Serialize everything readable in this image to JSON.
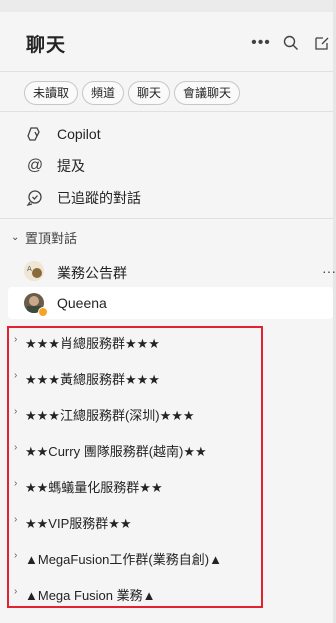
{
  "header": {
    "title": "聊天"
  },
  "filters": [
    "未讀取",
    "頻道",
    "聊天",
    "會議聊天"
  ],
  "nav": [
    {
      "label": "Copilot",
      "icon": "copilot-icon"
    },
    {
      "label": "提及",
      "icon": "at-icon"
    },
    {
      "label": "已追蹤的對話",
      "icon": "followed-chat-icon"
    }
  ],
  "pinned": {
    "section_label": "置頂對話",
    "chats": [
      {
        "label": "業務公告群",
        "avatar_text": "A"
      },
      {
        "label": "Queena"
      }
    ]
  },
  "groups": [
    "★★★肖總服務群★★★",
    "★★★黃總服務群★★★",
    "★★★江總服務群(深圳)★★★",
    "★★Curry 團隊服務群(越南)★★",
    "★★螞蟻量化服務群★★",
    "★★VIP服務群★★",
    "▲MegaFusion工作群(業務自創)▲",
    "▲Mega Fusion 業務▲"
  ],
  "colors": {
    "highlight": "#e0232e",
    "presence_away": "#f7a325"
  }
}
